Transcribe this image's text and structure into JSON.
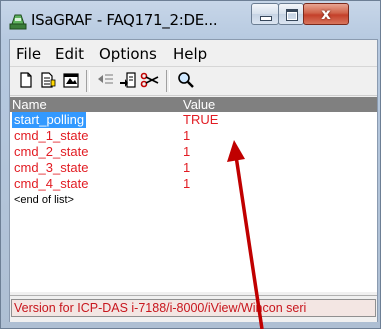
{
  "window": {
    "title": "ISaGRAF - FAQ171_2:DE...",
    "close_glyph": "x"
  },
  "menu": [
    {
      "label": "File"
    },
    {
      "label": "Edit"
    },
    {
      "label": "Options"
    },
    {
      "label": "Help"
    }
  ],
  "list": {
    "columns": {
      "name": "Name",
      "value": "Value"
    },
    "rows": [
      {
        "name": "start_polling",
        "value": "TRUE"
      },
      {
        "name": "cmd_1_state",
        "value": "1"
      },
      {
        "name": "cmd_2_state",
        "value": "1"
      },
      {
        "name": "cmd_3_state",
        "value": "1"
      },
      {
        "name": "cmd_4_state",
        "value": "1"
      }
    ],
    "end_label": "<end of list>"
  },
  "status": {
    "text": "Version for ICP-DAS i-7188/i-8000/iView/Wincon seri"
  },
  "colors": {
    "selection": "#3399ff",
    "variable_text": "#e21c23",
    "annotation_arrow": "#c00000"
  }
}
